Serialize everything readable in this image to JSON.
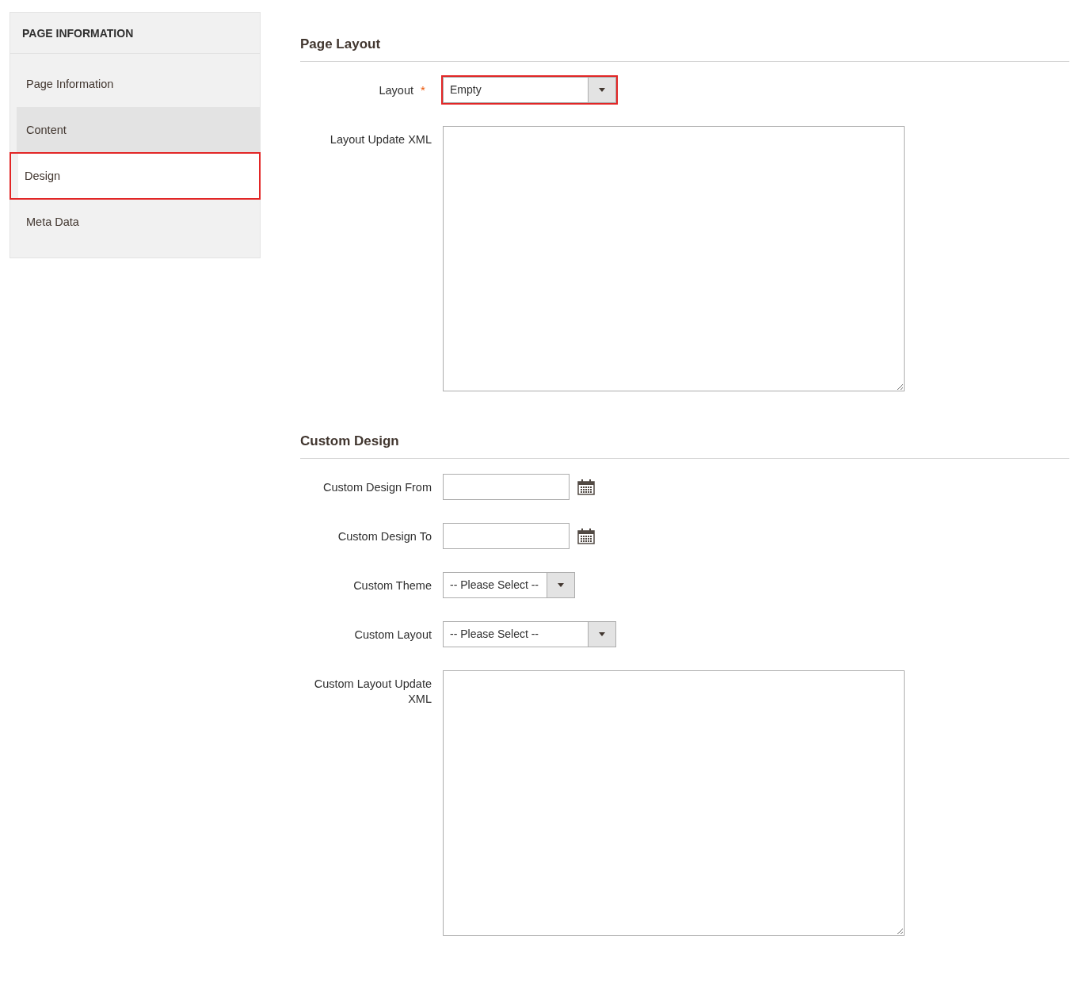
{
  "sidebar": {
    "title": "PAGE INFORMATION",
    "items": [
      {
        "label": "Page Information",
        "selected": false,
        "hovered": false,
        "highlighted": false
      },
      {
        "label": "Content",
        "selected": false,
        "hovered": true,
        "highlighted": false
      },
      {
        "label": "Design",
        "selected": true,
        "hovered": false,
        "highlighted": true
      },
      {
        "label": "Meta Data",
        "selected": false,
        "hovered": false,
        "highlighted": false
      }
    ]
  },
  "sections": [
    {
      "title": "Page Layout",
      "fields": [
        {
          "kind": "select",
          "label": "Layout",
          "required_mark": "*",
          "value": "Empty",
          "highlighted": true
        },
        {
          "kind": "textarea",
          "label": "Layout Update XML",
          "highlighted": false
        }
      ]
    },
    {
      "title": "Custom Design",
      "fields": [
        {
          "kind": "date",
          "label": "Custom Design From",
          "highlighted": false
        },
        {
          "kind": "date",
          "label": "Custom Design To",
          "highlighted": false
        },
        {
          "kind": "compact-select",
          "label": "Custom Theme",
          "value": "-- Please Select --",
          "highlighted": false
        },
        {
          "kind": "select",
          "label": "Custom Layout",
          "value": "-- Please Select --",
          "highlighted": false
        },
        {
          "kind": "textarea",
          "label": "Custom Layout Update XML",
          "highlighted": false
        }
      ]
    }
  ]
}
